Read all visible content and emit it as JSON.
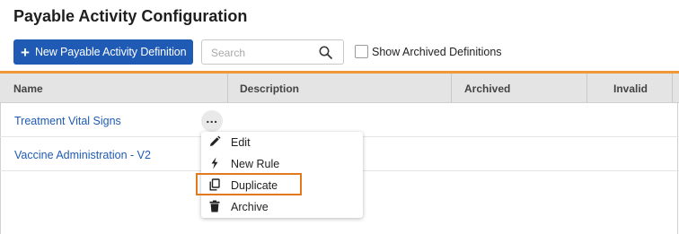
{
  "page": {
    "title": "Payable Activity Configuration"
  },
  "toolbar": {
    "new_button_label": "New Payable Activity Definition",
    "search_placeholder": "Search",
    "show_archived_label": "Show Archived Definitions",
    "show_archived_checked": false
  },
  "table": {
    "columns": [
      "Name",
      "Description",
      "Archived",
      "Invalid"
    ],
    "rows": [
      {
        "name": "Treatment Vital Signs"
      },
      {
        "name": "Vaccine Administration - V2"
      }
    ]
  },
  "context_menu": {
    "items": [
      {
        "label": "Edit",
        "icon": "pencil-icon"
      },
      {
        "label": "New Rule",
        "icon": "lightning-icon"
      },
      {
        "label": "Duplicate",
        "icon": "copy-icon"
      },
      {
        "label": "Archive",
        "icon": "trash-icon"
      }
    ],
    "highlighted": "Duplicate"
  },
  "colors": {
    "primary": "#1f5bb5",
    "accent": "#f0973a",
    "highlight": "#e07a1c",
    "header_bg": "#e4e4e4"
  }
}
